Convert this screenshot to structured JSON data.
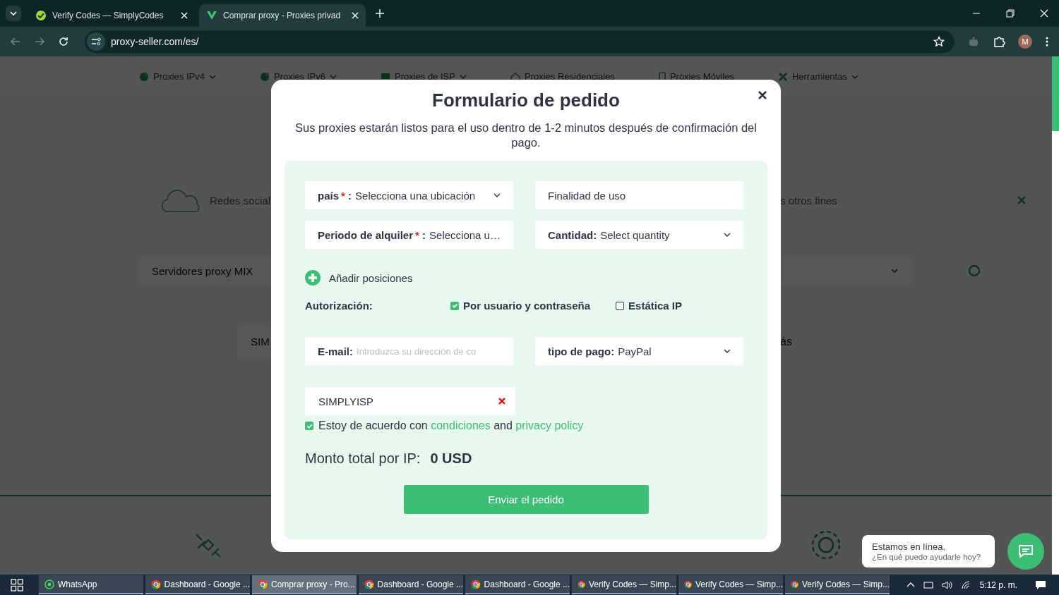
{
  "browser": {
    "tabs": [
      {
        "title": "Verify Codes — SimplyCodes",
        "selected": false
      },
      {
        "title": "Comprar proxy - Proxies privad",
        "selected": true
      }
    ],
    "url": "proxy-seller.com/es/",
    "profile": "M"
  },
  "nav": {
    "items": [
      {
        "label": "Proxies IPv4",
        "dropdown": true
      },
      {
        "label": "Proxies IPv6",
        "dropdown": true
      },
      {
        "label": "Proxies de ISP",
        "dropdown": true
      },
      {
        "label": "Proxies Residenciales",
        "dropdown": false
      },
      {
        "label": "Proxies Móviles",
        "dropdown": false
      },
      {
        "label": "Herramientas",
        "dropdown": true
      }
    ]
  },
  "background": {
    "left_text": "Redes social",
    "right_text": "s otros fines",
    "left_box": "Servidores proxy MIX",
    "left_box_2": "SIM",
    "right_text_2": "ás"
  },
  "modal": {
    "title": "Formulario de pedido",
    "subtitle": "Sus proxies estarán listos para el uso dentro de 1-2 minutos después de confirmación del pago.",
    "fields": [
      {
        "kind": "select",
        "label": "país",
        "required_mark": "*",
        "label_end": ":",
        "value": "Selecciona una ubicación"
      },
      {
        "kind": "input",
        "placeholder": "Finalidad de uso"
      },
      {
        "kind": "select",
        "label": "Periodo de alquiler",
        "required_mark": "*",
        "label_end": ":",
        "value": "Selecciona u…"
      },
      {
        "kind": "select",
        "label": "Cantidad:",
        "value": "Select quantity"
      }
    ],
    "add_positions": "Añadir posiciones",
    "authorization": {
      "label": "Autorización:",
      "options": [
        {
          "label": "Por usuario y contraseña",
          "checked": true
        },
        {
          "label": "Estática IP",
          "checked": false
        }
      ]
    },
    "email": {
      "label": "E-mail:",
      "placeholder": "Introduzca su dirección de co"
    },
    "payment": {
      "label": "tipo de pago:",
      "value": "PayPal"
    },
    "coupon": {
      "value": "SIMPLYISP"
    },
    "agreement": {
      "checked": true,
      "text": "Estoy de acuerdo con",
      "link_1": "condiciones",
      "joiner": "and",
      "link_2": "privacy policy"
    },
    "total": {
      "label": "Monto total por IP:",
      "value": "0 USD"
    },
    "submit": "Enviar el pedido"
  },
  "chat": {
    "title": "Estamos en línea.",
    "subtitle": "¿En qué puedo ayudarle hoy?"
  },
  "taskbar": {
    "items": [
      {
        "label": "WhatsApp",
        "selected": false
      },
      {
        "label": "Dashboard - Google ...",
        "selected": false
      },
      {
        "label": "Comprar proxy - Pro...",
        "selected": true
      },
      {
        "label": "Dashboard - Google ...",
        "selected": false
      },
      {
        "label": "Dashboard - Google ...",
        "selected": false
      },
      {
        "label": "Verify Codes — Simp...",
        "selected": false
      },
      {
        "label": "Verify Codes — Simp...",
        "selected": false
      },
      {
        "label": "Verify Codes — Simp...",
        "selected": false
      }
    ],
    "time": "5:12 p. m."
  }
}
